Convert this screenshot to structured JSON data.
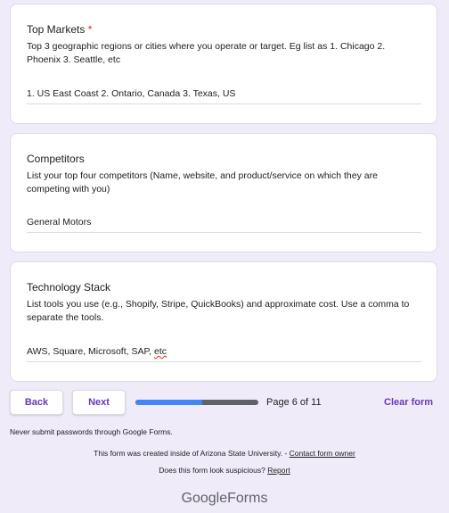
{
  "questions": [
    {
      "title": "Top Markets",
      "required_mark": "*",
      "description": "Top 3 geographic regions or cities where you operate or target. Eg list as 1. Chicago 2. Phoenix 3. Seattle, etc",
      "answer": "1. US East Coast 2. Ontario, Canada 3. Texas, US"
    },
    {
      "title": "Competitors",
      "description": "List your top four competitors (Name, website, and product/service on which they are competing with you)",
      "answer": "General Motors"
    },
    {
      "title": "Technology Stack",
      "description": "List tools you use (e.g., Shopify, Stripe, QuickBooks) and approximate cost. Use a comma to separate the tools.",
      "answer_prefix": "AWS, Square, Microsoft, SAP, ",
      "answer_misspelled": "etc"
    }
  ],
  "nav": {
    "back_label": "Back",
    "next_label": "Next",
    "page_label": "Page 6 of 11",
    "progress_fraction": 0.545,
    "clear_label": "Clear form"
  },
  "footer": {
    "password_warning": "Never submit passwords through Google Forms.",
    "created_text": "This form was created inside of Arizona State University. - ",
    "contact_link": "Contact form owner",
    "suspicious_text": "Does this form look suspicious? ",
    "report_link": "Report",
    "brand_google": "Google",
    "brand_forms": "Forms"
  },
  "colors": {
    "background": "#f0ebf8",
    "accent": "#673ab7",
    "progress": "#4285f4",
    "required": "#d93025"
  }
}
